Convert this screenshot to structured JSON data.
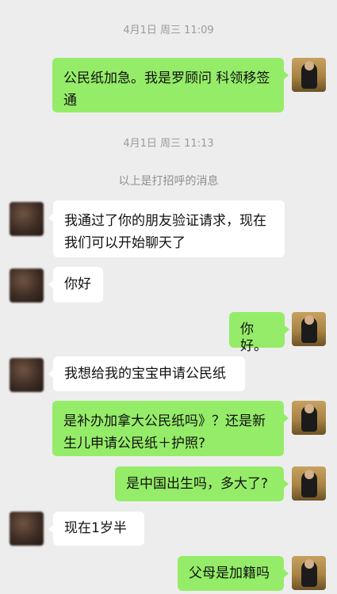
{
  "chat": {
    "timestamps": [
      "4月1日 周三 11:09",
      "4月1日 周三 11:13"
    ],
    "system_notice": "以上是打招呼的消息",
    "messages": [
      {
        "side": "right",
        "text": "公民纸加急。我是罗顾问 科领移签通"
      },
      {
        "side": "left",
        "text": "我通过了你的朋友验证请求，现在我们可以开始聊天了"
      },
      {
        "side": "left",
        "text": "你好"
      },
      {
        "side": "right",
        "text": "你好。"
      },
      {
        "side": "left",
        "text": "我想给我的宝宝申请公民纸"
      },
      {
        "side": "right",
        "text": "是补办加拿大公民纸吗》？还是新生儿申请公民纸＋护照?"
      },
      {
        "side": "right",
        "text": "是中国出生吗，多大了?"
      },
      {
        "side": "left",
        "text": "现在1岁半"
      },
      {
        "side": "right",
        "text": "父母是加籍吗"
      }
    ]
  }
}
